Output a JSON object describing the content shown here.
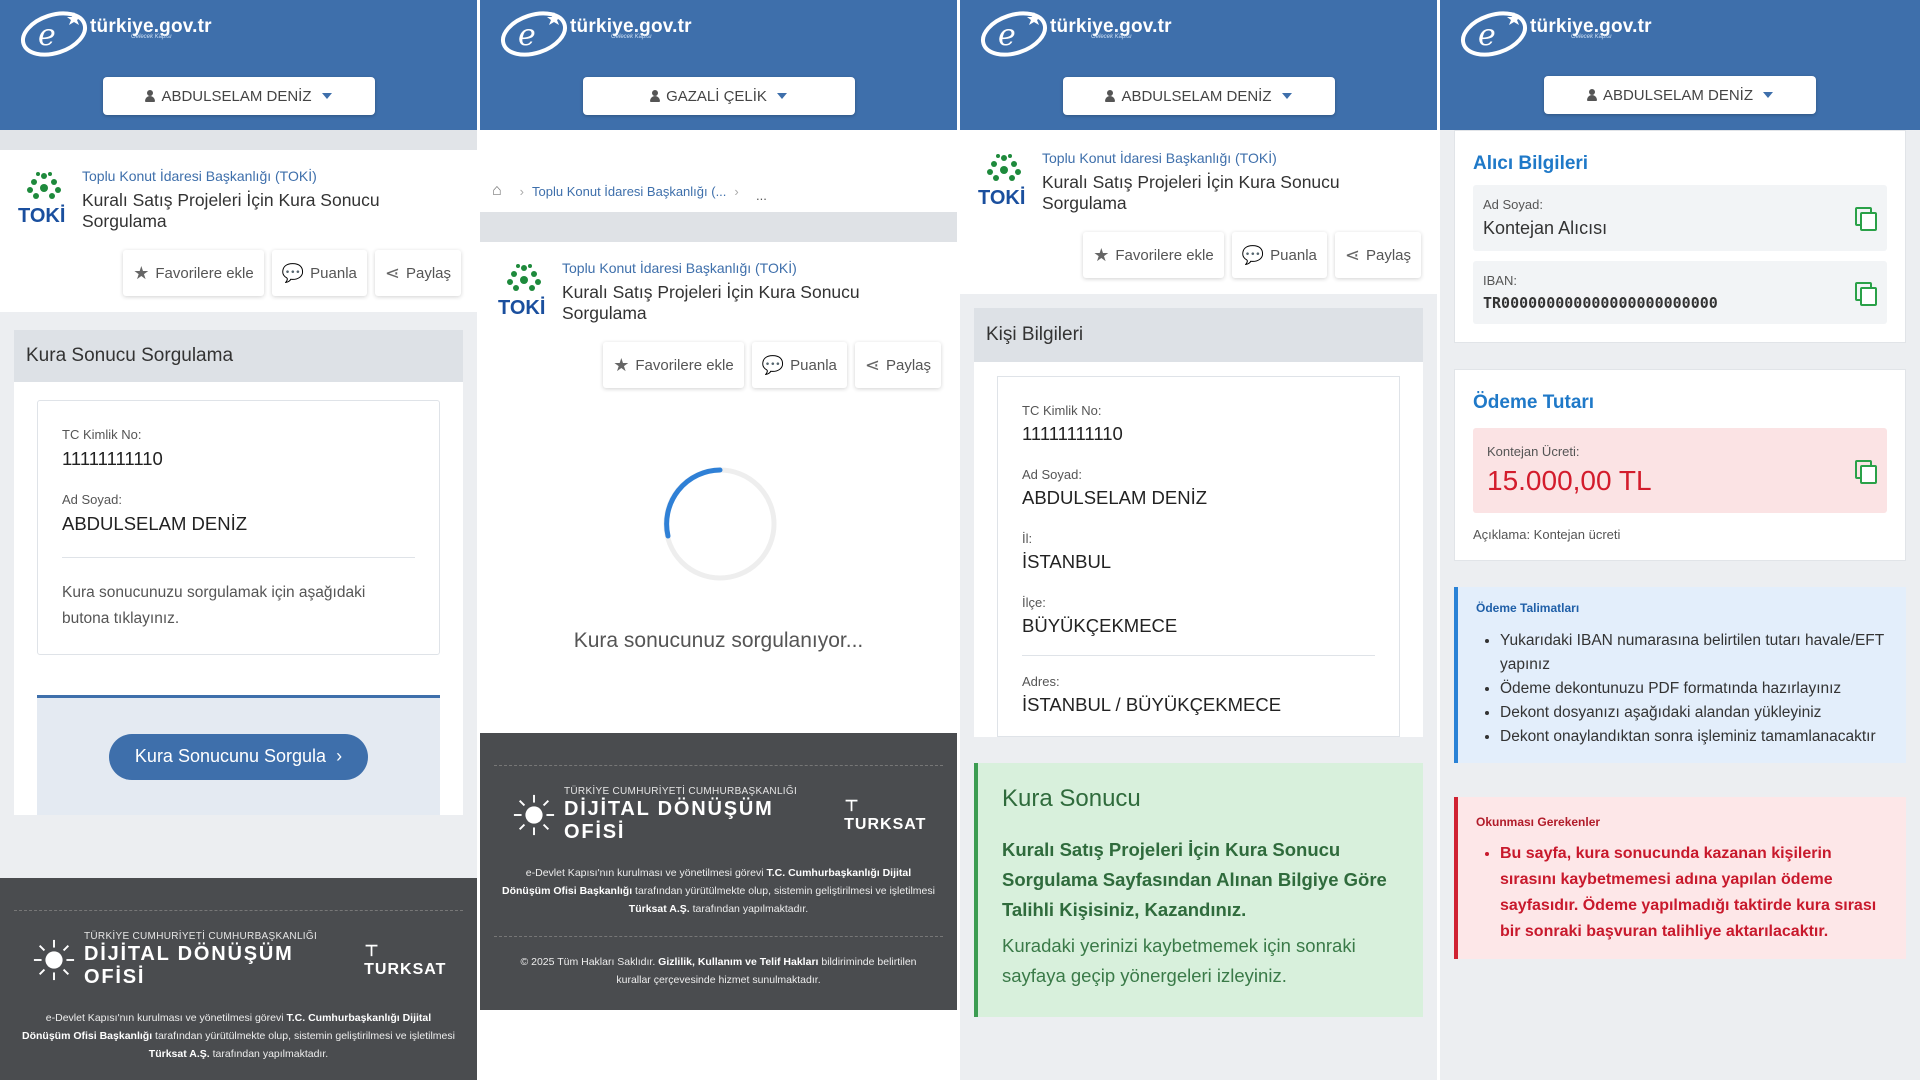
{
  "brand": {
    "site": "türkiye.gov.tr",
    "tagline": "Gelecek Kapısı"
  },
  "panels": {
    "p1": {
      "user": "ABDULSELAM DENİZ"
    },
    "p2": {
      "user": "GAZALİ ÇELİK"
    },
    "p3": {
      "user": "ABDULSELAM DENİZ"
    },
    "p4": {
      "user": "ABDULSELAM DENİZ"
    }
  },
  "toki": {
    "org": "Toplu Konut İdaresi Başkanlığı (TOKİ)",
    "title": "Kuralı Satış Projeleri İçin Kura Sonucu Sorgulama",
    "logo_text": "TOKİ",
    "favorites": "Favorilere ekle",
    "rate": "Puanla",
    "share": "Paylaş"
  },
  "p1": {
    "section_title": "Kura Sonucu Sorgulama",
    "tc_label": "TC Kimlik No:",
    "tc_value": "11111111110",
    "name_label": "Ad Soyad:",
    "name_value": "ABDULSELAM DENİZ",
    "description": "Kura sonucunuzu sorgulamak için aşağıdaki butona tıklayınız.",
    "button": "Kura Sonucunu Sorgula"
  },
  "p2": {
    "breadcrumb": "Toplu Konut İdaresi Başkanlığı (...",
    "breadcrumb_more": "...",
    "loading": "Kura sonucunuz sorgulanıyor..."
  },
  "p3": {
    "section_title": "Kişi Bilgileri",
    "tc_label": "TC Kimlik No:",
    "tc_value": "11111111110",
    "name_label": "Ad Soyad:",
    "name_value": "ABDULSELAM DENİZ",
    "il_label": "İl:",
    "il_value": "İSTANBUL",
    "ilce_label": "İlçe:",
    "ilce_value": "BÜYÜKÇEKMECE",
    "adres_label": "Adres:",
    "adres_value": "İSTANBUL / BÜYÜKÇEKMECE",
    "result_title": "Kura Sonucu",
    "result_bold": "Kuralı Satış Projeleri İçin Kura Sonucu Sorgulama Sayfasından Alınan Bilgiye Göre Talihli Kişisiniz, Kazandınız.",
    "result_note": "Kuradaki yerinizi kaybetmemek için sonraki sayfaya geçip yönergeleri izleyiniz."
  },
  "p4": {
    "recipient_title": "Alıcı Bilgileri",
    "name_label": "Ad Soyad:",
    "name_value": "Kontejan Alıcısı",
    "iban_label": "IBAN:",
    "iban_value": "TR000000000000000000000000",
    "payment_title": "Ödeme Tutarı",
    "fee_label": "Kontejan Ücreti:",
    "fee_value": "15.000,00 TL",
    "fee_note": "Açıklama: Kontejan ücreti",
    "instructions_title": "Ödeme Talimatları",
    "instructions": [
      "Yukarıdaki IBAN numarasına belirtilen tutarı havale/EFT yapınız",
      "Ödeme dekontunuzu PDF formatında hazırlayınız",
      "Dekont dosyanızı aşağıdaki alandan yükleyiniz",
      "Dekont onaylandıktan sonra işleminiz tamamlanacaktır"
    ],
    "warning_title": "Okunması Gerekenler",
    "warning": "Bu sayfa, kura sonucunda kazanan kişilerin sırasını kaybetmemesi adına yapılan ödeme sayfasıdır. Ödeme yapılmadığı taktirde kura sırası bir sonraki başvuran talihliye aktarılacaktır."
  },
  "footer": {
    "ddo_small": "TÜRKİYE CUMHURİYETİ CUMHURBAŞKANLIĞI",
    "ddo_big": "DİJİTAL DÖNÜŞÜM OFİSİ",
    "turksat": "TURKSAT",
    "text_1": "e-Devlet Kapısı'nın kurulması ve yönetilmesi görevi",
    "text_b1": "T.C. Cumhurbaşkanlığı Dijital Dönüşüm Ofisi Başkanlığı",
    "text_2": "tarafından yürütülmekte olup, sistemin geliştirilmesi ve işletilmesi",
    "text_b2": "Türksat A.Ş.",
    "text_3": "tarafından yapılmaktadır.",
    "copyright_1": "© 2025 Tüm Hakları Saklıdır.",
    "copyright_b": "Gizlilik, Kullanım ve Telif Hakları",
    "copyright_2": "bildiriminde belirtilen kurallar çerçevesinde hizmet sunulmaktadır."
  },
  "colors": {
    "header": "#3e6fab",
    "footer": "#4a4c4f",
    "success": "#3c9c52",
    "danger": "#d31c2c",
    "info": "#2a82d6"
  }
}
